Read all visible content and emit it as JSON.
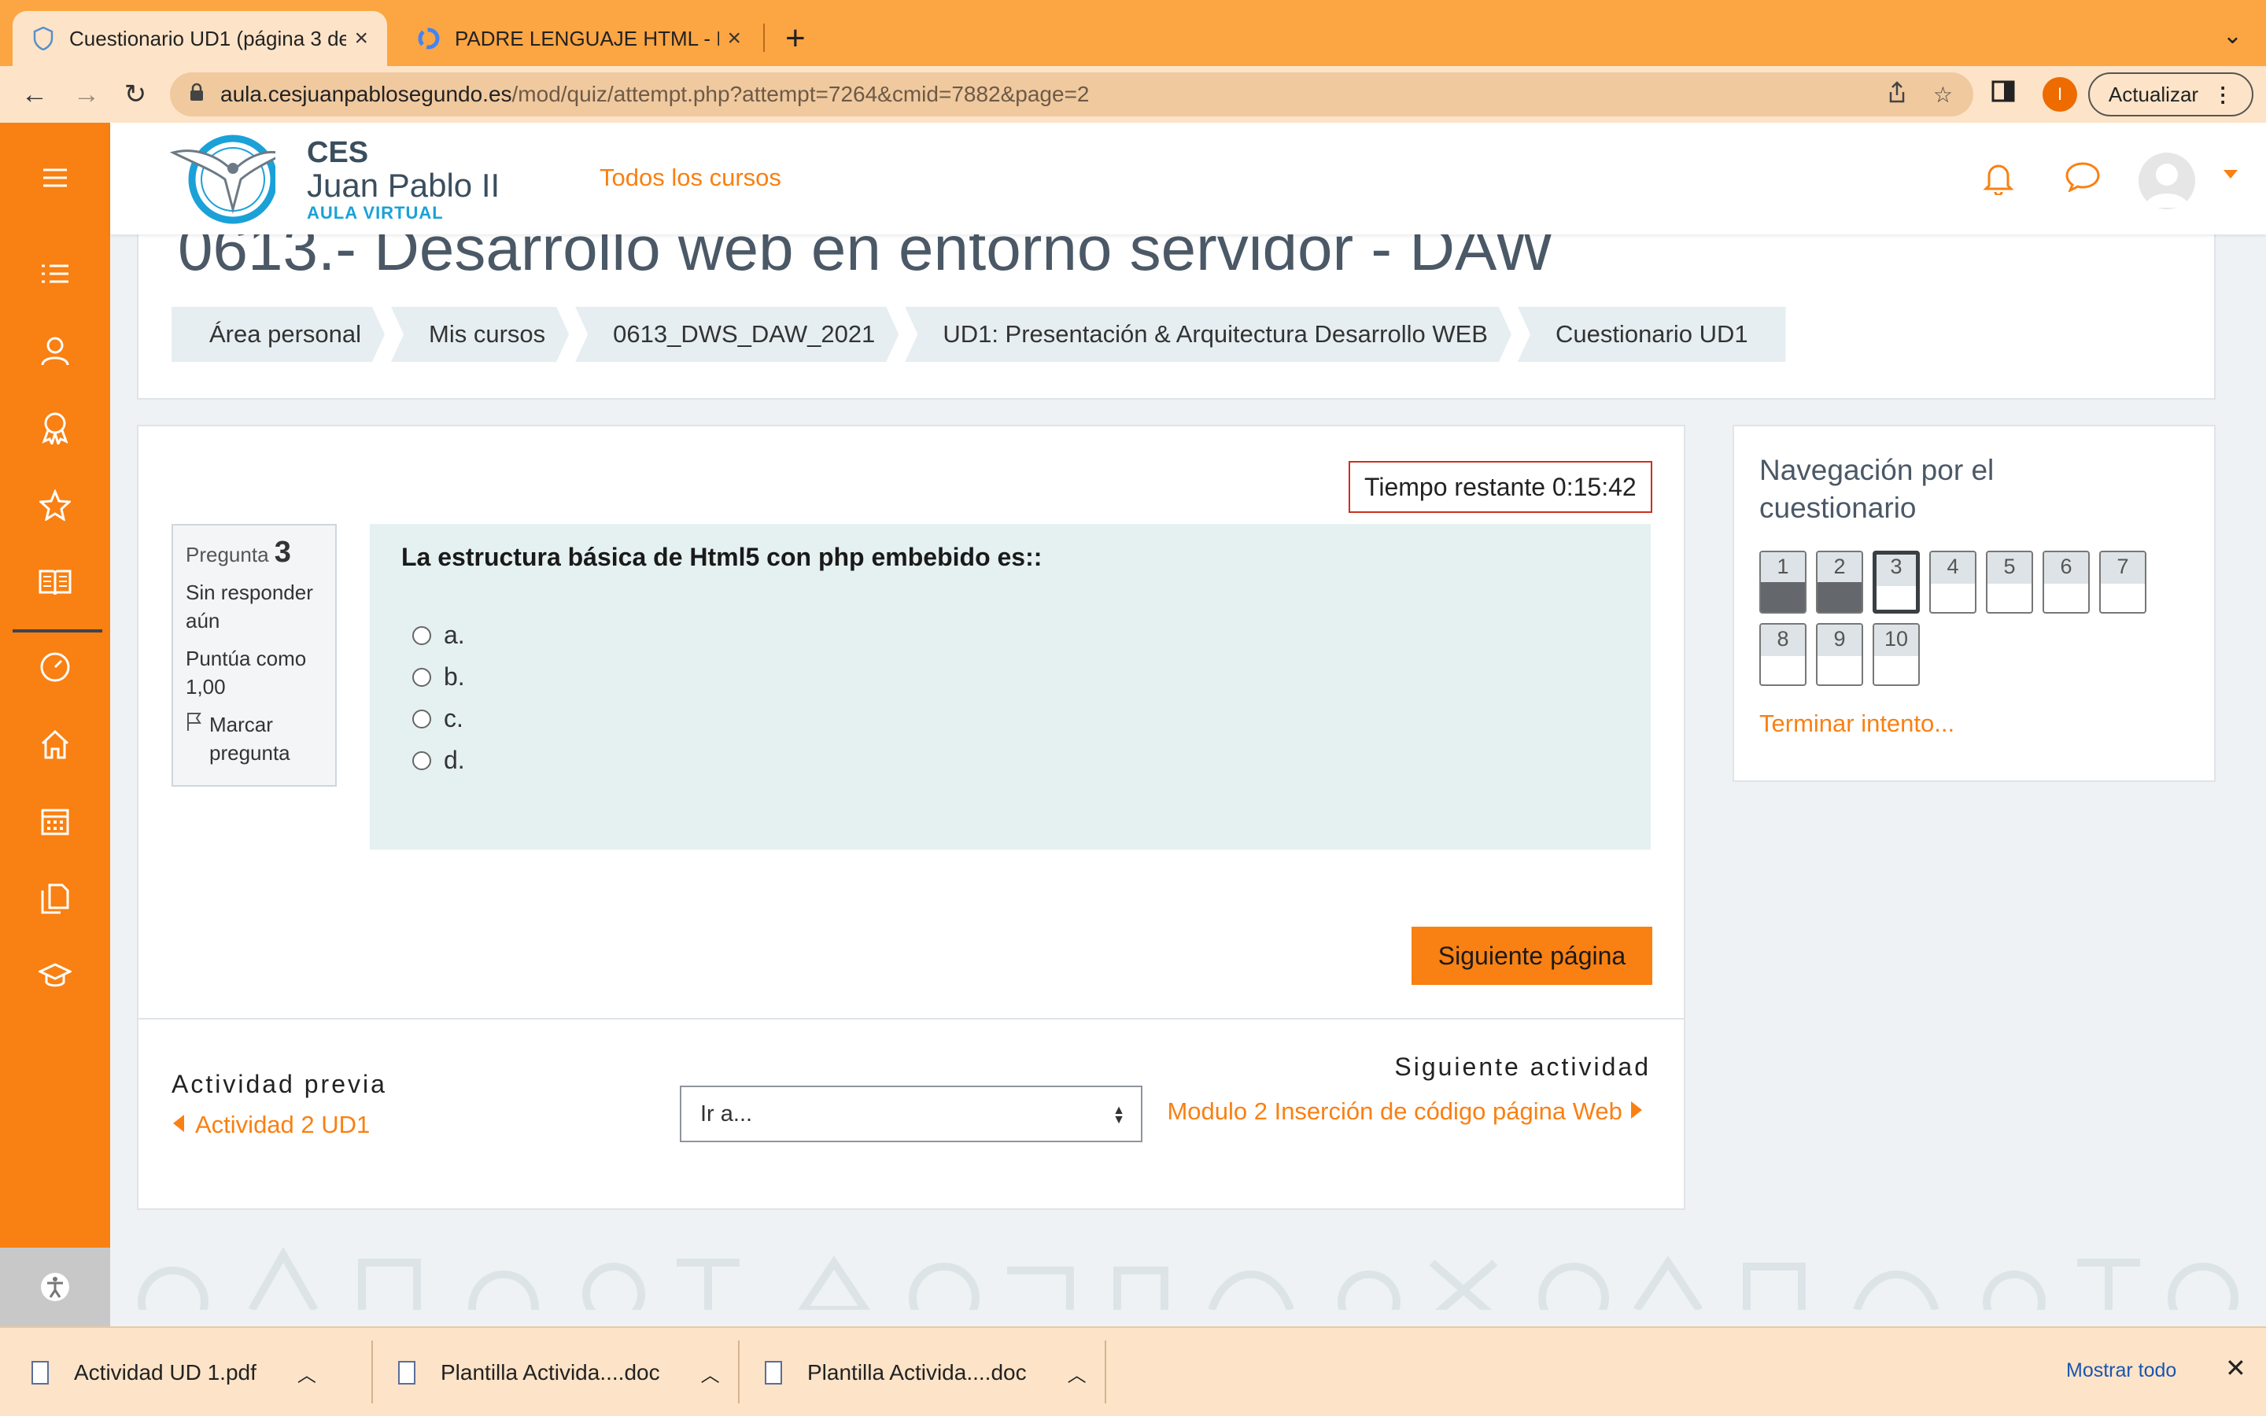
{
  "browser": {
    "tabs": [
      {
        "title": "Cuestionario UD1 (página 3 de",
        "active": true
      },
      {
        "title": "PADRE LENGUAJE HTML - Bus",
        "active": false
      }
    ],
    "url_host": "aula.cesjuanpablosegundo.es",
    "url_path": "/mod/quiz/attempt.php?attempt=7264&cmid=7882&page=2",
    "profile_initial": "I",
    "update_label": "Actualizar",
    "accent_color": "#fca543"
  },
  "header": {
    "brand_line1": "CES",
    "brand_line2": "Juan Pablo II",
    "brand_line3": "AULA VIRTUAL",
    "all_courses": "Todos los cursos"
  },
  "page": {
    "course_title": "0613.- Desarrollo web en entorno servidor - DAW",
    "breadcrumb": [
      "Área personal",
      "Mis cursos",
      "0613_DWS_DAW_2021",
      "UD1: Presentación & Arquitectura Desarrollo WEB",
      "Cuestionario UD1"
    ]
  },
  "quiz": {
    "timer": "Tiempo restante 0:15:42",
    "question_label": "Pregunta",
    "question_number": "3",
    "status": "Sin responder aún",
    "grade": "Puntúa como 1,00",
    "flag_label": "Marcar pregunta",
    "question_text": "La estructura básica de Html5 con php embebido es::",
    "options": [
      "a.",
      "b.",
      "c.",
      "d."
    ],
    "next_button": "Siguiente página",
    "prev_activity_label": "Actividad previa",
    "prev_activity_link": "Actividad 2 UD1",
    "jump_select": "Ir a...",
    "next_activity_label": "Siguiente actividad",
    "next_activity_link": "Modulo 2 Inserción de código página Web"
  },
  "navigation": {
    "title": "Navegación por el cuestionario",
    "questions": [
      {
        "n": "1",
        "state": "answered"
      },
      {
        "n": "2",
        "state": "answered"
      },
      {
        "n": "3",
        "state": "current"
      },
      {
        "n": "4",
        "state": "open"
      },
      {
        "n": "5",
        "state": "open"
      },
      {
        "n": "6",
        "state": "open"
      },
      {
        "n": "7",
        "state": "open"
      },
      {
        "n": "8",
        "state": "open"
      },
      {
        "n": "9",
        "state": "open"
      },
      {
        "n": "10",
        "state": "open"
      }
    ],
    "finish": "Terminar intento..."
  },
  "downloads": {
    "items": [
      "Actividad UD 1.pdf",
      "Plantilla Activida....doc",
      "Plantilla Activida....doc"
    ],
    "show_all": "Mostrar todo"
  }
}
